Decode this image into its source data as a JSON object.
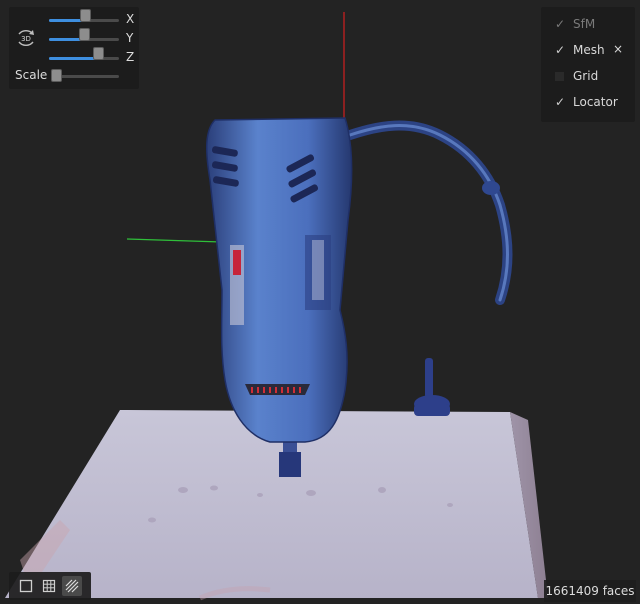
{
  "transform": {
    "rotate_icon_text": "3D",
    "axes": [
      {
        "label": "X",
        "value": 0.52
      },
      {
        "label": "Y",
        "value": 0.5
      },
      {
        "label": "Z",
        "value": 0.7
      }
    ],
    "scale_label": "Scale",
    "scale_value": 0.0,
    "accent": "#3e8fe0"
  },
  "layers": [
    {
      "label": "SfM",
      "checked": true,
      "disabled": true
    },
    {
      "label": "Mesh",
      "checked": true,
      "disabled": false,
      "close": "×"
    },
    {
      "label": "Grid",
      "checked": false,
      "disabled": false
    },
    {
      "label": "Locator",
      "checked": true,
      "disabled": false
    }
  ],
  "check_glyph": "✓",
  "view_modes": [
    {
      "name": "solid",
      "icon": "square-icon",
      "active": false
    },
    {
      "name": "wireframe",
      "icon": "grid-icon",
      "active": false
    },
    {
      "name": "textured",
      "icon": "hatch-icon",
      "active": true
    }
  ],
  "face_count_text": "1661409 faces",
  "colors": {
    "x_axis": "#2ecc40",
    "y_axis": "#e02020",
    "mesh_blue": "#3f64b4",
    "base": "#c9c7d6"
  }
}
